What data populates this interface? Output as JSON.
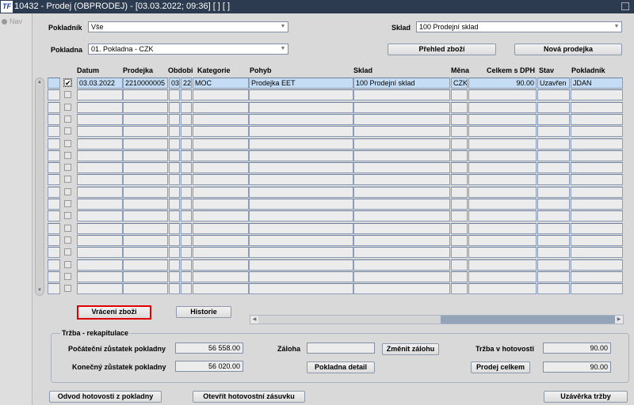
{
  "window": {
    "title": "10432 - Prodej (OBPRODEJ) - [03.03.2022; 09:36]  [ ]  [ ]",
    "logo": "TF"
  },
  "nav": {
    "label": "Nav"
  },
  "filters": {
    "pokladnik_label": "Pokladník",
    "pokladnik_value": "Vše",
    "pokladna_label": "Pokladna",
    "pokladna_value": "01. Pokladna - CZK",
    "sklad_label": "Sklad",
    "sklad_value": "100 Prodejní sklad"
  },
  "buttons": {
    "prehled": "Přehled zboží",
    "nova": "Nová prodejka",
    "vraceni": "Vráceni zboži",
    "historie": "Historie",
    "zmenit": "Změnit zálohu",
    "detail": "Pokladna detail",
    "prodej_celkem": "Prodej celkem",
    "odvod": "Odvod hotovosti z pokladny",
    "otevrit": "Otevřít hotovostní zásuvku",
    "uzaverka": "Uzávěrka tržby"
  },
  "grid": {
    "headers": {
      "datum": "Datum",
      "prodejka": "Prodejka",
      "obdobi": "Obdobi",
      "kategorie": "Kategorie",
      "pohyb": "Pohyb",
      "sklad": "Sklad",
      "mena": "Měna",
      "celkem": "Celkem s DPH",
      "stav": "Stav",
      "pokladnik": "Pokladník"
    },
    "rows": [
      {
        "checked": true,
        "datum": "03.03.2022",
        "prodejka": "2210000005",
        "obd1": "03",
        "obd2": "22",
        "kategorie": "MOC",
        "pohyb": "Prodejka EET",
        "sklad": "100 Prodejní sklad",
        "mena": "CZK",
        "celkem": "90.00",
        "stav": "Uzavřen",
        "pokladnik": "JDAN"
      },
      {},
      {},
      {},
      {},
      {},
      {},
      {},
      {},
      {},
      {},
      {},
      {},
      {},
      {},
      {},
      {},
      {}
    ]
  },
  "recap": {
    "title": "Tržba - rekapitulace",
    "pocatecni_label": "Počáteční zůstatek pokladny",
    "pocatecni": "56 558.00",
    "konecny_label": "Konečný zůstatek pokladny",
    "konecny": "56 020.00",
    "zaloha_label": "Záloha",
    "zaloha": "",
    "trzba_label": "Tržba v hotovosti",
    "trzba": "90.00",
    "prodej_celkem": "90.00"
  },
  "colors": {
    "titlebar": "#2c3b50",
    "selected_row": "#c4ddf5",
    "highlight": "#e00000"
  }
}
